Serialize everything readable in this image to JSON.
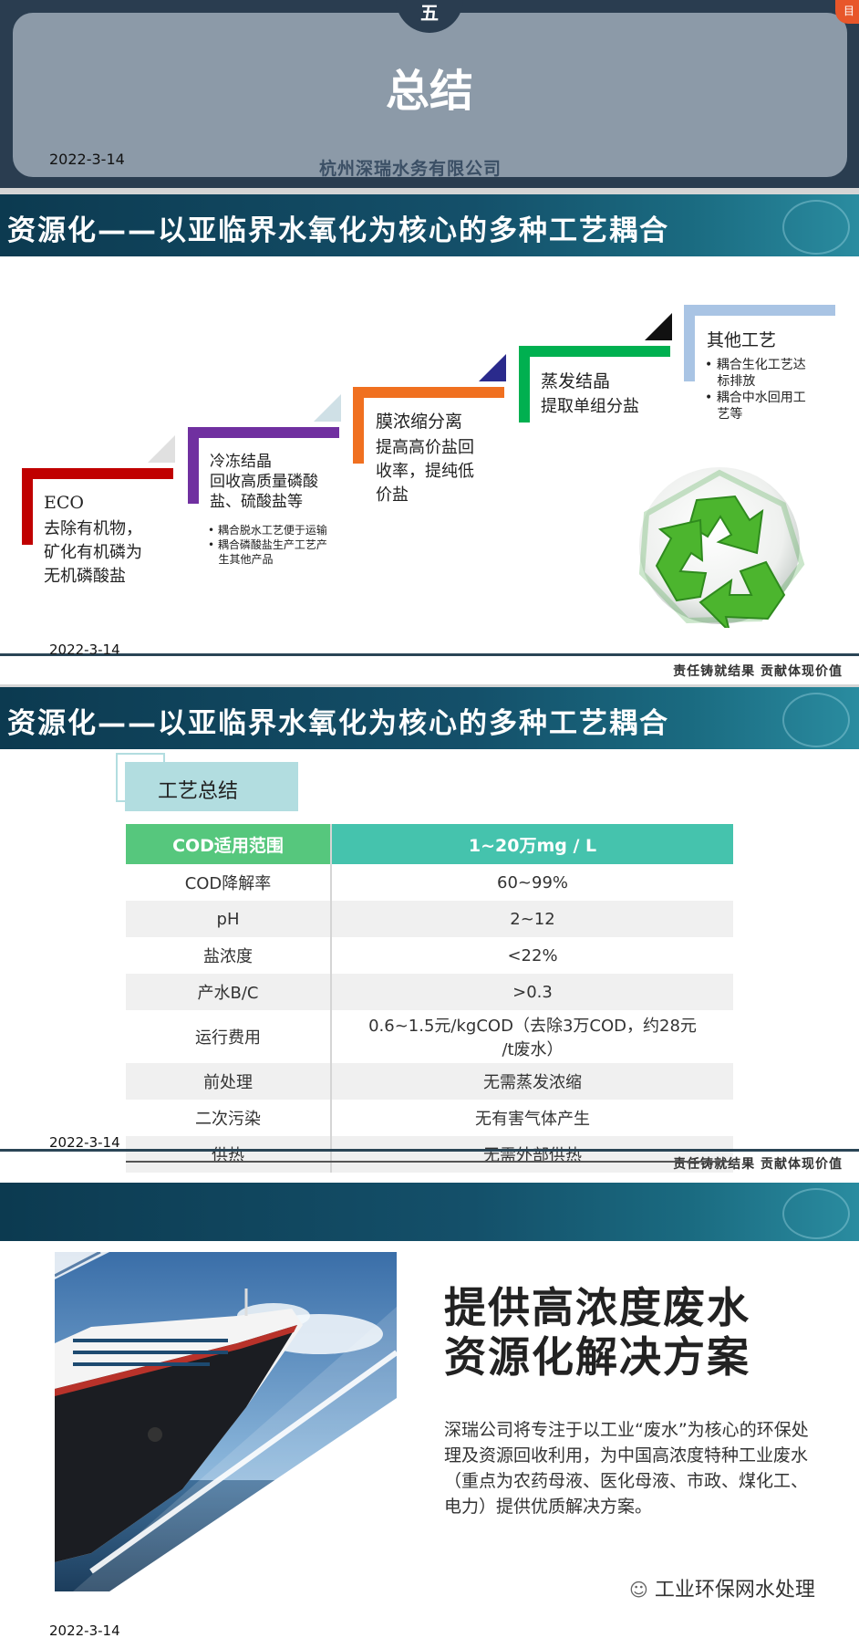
{
  "slide1": {
    "number": "五",
    "title": "总结",
    "date": "2022-3-14",
    "company": "杭州深瑞水务有限公司",
    "badge": "目"
  },
  "slide2": {
    "header": "资源化——以亚临界水氧化为核心的多种工艺耦合",
    "steps": [
      {
        "title": "ECO",
        "text": [
          "去除有机物，",
          "矿化有机磷为",
          "无机磷酸盐"
        ],
        "color": "#c00000"
      },
      {
        "title": "冷冻结晶",
        "text": [
          "回收高质量磷酸",
          "盐、硫酸盐等"
        ],
        "bullets": [
          "耦合脱水工艺便于运输",
          "耦合磷酸盐生产工艺产",
          "生其他产品"
        ],
        "color": "#7030a0"
      },
      {
        "title": "膜浓缩分离",
        "text": [
          "提高高价盐回",
          "收率，提纯低",
          "价盐"
        ],
        "color": "#f07020"
      },
      {
        "title": "蒸发结晶",
        "text": [
          "提取单组分盐"
        ],
        "color": "#00b050"
      },
      {
        "title": "其他工艺",
        "bullets": [
          "耦合生化工艺达",
          "标排放",
          "耦合中水回用工",
          "艺等"
        ],
        "color": "#a9c4e4"
      }
    ],
    "date": "2022-3-14",
    "slogan": "责任铸就结果    贡献体现价值"
  },
  "slide3": {
    "header": "资源化——以亚临界水氧化为核心的多种工艺耦合",
    "tag": "工艺总结",
    "table_header": [
      "COD适用范围",
      "1~20万mg / L"
    ],
    "rows": [
      [
        "COD降解率",
        "60~99%"
      ],
      [
        "pH",
        "2~12"
      ],
      [
        "盐浓度",
        "<22%"
      ],
      [
        "产水B/C",
        ">0.3"
      ],
      [
        "运行费用",
        "0.6~1.5元/kgCOD（去除3万COD，约28元",
        "/t废水）"
      ],
      [
        "前处理",
        "无需蒸发浓缩"
      ],
      [
        "二次污染",
        "无有害气体产生"
      ],
      [
        "供热",
        "无需外部供热"
      ]
    ],
    "date": "2022-3-14",
    "slogan": "责任铸就结果    贡献体现价值"
  },
  "slide4": {
    "title_line1": "提供高浓度废水",
    "title_line2": "资源化解决方案",
    "paragraph": "深瑞公司将专注于以工业“废水”为核心的环保处理及资源回收利用，为中国高浓度特种工业废水（重点为农药母液、医化母液、市政、煤化工、电力）提供优质解决方案。",
    "watermark": "工业环保网水处理",
    "date": "2022-3-14"
  }
}
